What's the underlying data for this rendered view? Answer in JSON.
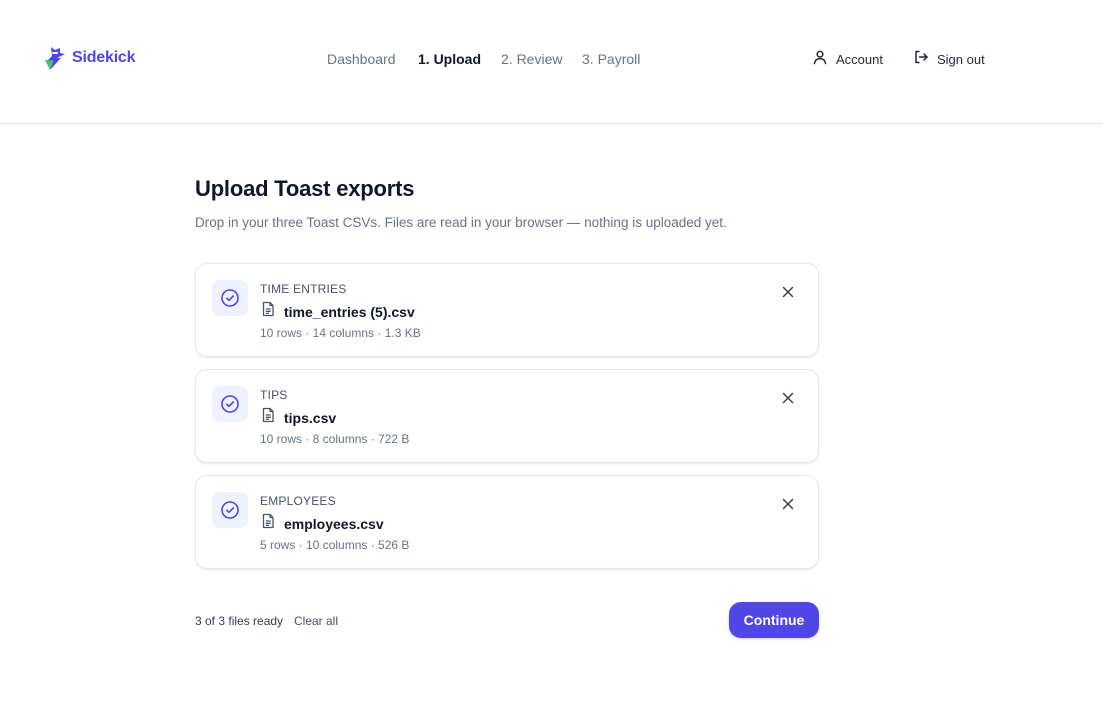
{
  "brand": {
    "name": "Sidekick",
    "accent": "#4f46e5"
  },
  "nav": {
    "items": [
      {
        "label": "Dashboard",
        "active": false
      },
      {
        "label": "1. Upload",
        "active": true
      },
      {
        "label": "2. Review",
        "active": false
      },
      {
        "label": "3. Payroll",
        "active": false
      }
    ]
  },
  "header": {
    "account_label": "Account",
    "signout_label": "Sign out",
    "account_icon": "user-icon",
    "signout_icon": "sign-out-icon"
  },
  "page": {
    "title": "Upload Toast exports",
    "subtitle": "Drop in your three Toast CSVs. Files are read in your browser — nothing is uploaded yet."
  },
  "files": [
    {
      "label": "TIME ENTRIES",
      "filename": "time_entries (5).csv",
      "meta": "10 rows · 14 columns · 1.3 KB"
    },
    {
      "label": "TIPS",
      "filename": "tips.csv",
      "meta": "10 rows · 8 columns · 722 B"
    },
    {
      "label": "EMPLOYEES",
      "filename": "employees.csv",
      "meta": "5 rows · 10 columns · 526 B"
    }
  ],
  "footer": {
    "ready_count": "3 of 3 files ready",
    "clear_label": "Clear all",
    "continue_label": "Continue"
  }
}
